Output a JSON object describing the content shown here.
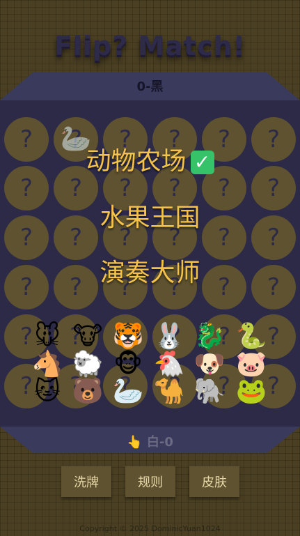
{
  "title": "Flip? Match!",
  "score_top": "0-黑",
  "score_bottom": "白-0",
  "score_bottom_icon": "hand-pointing-icon",
  "card_face": "?",
  "overlay_items": [
    {
      "label": "动物农场",
      "checked": true
    },
    {
      "label": "水果王国",
      "checked": false
    },
    {
      "label": "演奏大师",
      "checked": false
    }
  ],
  "revealed_card": "🦢",
  "animals": [
    "🐭",
    "🐮",
    "🐯",
    "🐰",
    "🐉",
    "🐍",
    "🐴",
    "🐑",
    "🐵",
    "🐔",
    "🐶",
    "🐷",
    "🐱",
    "🐻",
    "🦢",
    "🐪",
    "🐘",
    "🐸"
  ],
  "buttons": {
    "shuffle": "洗牌",
    "rules": "规则",
    "skin": "皮肤"
  },
  "footer": "Copyright © 2025 DominicYuan1024",
  "colors": {
    "accent": "#f4c24b",
    "board": "#2c2a47",
    "card": "#5e5230"
  }
}
